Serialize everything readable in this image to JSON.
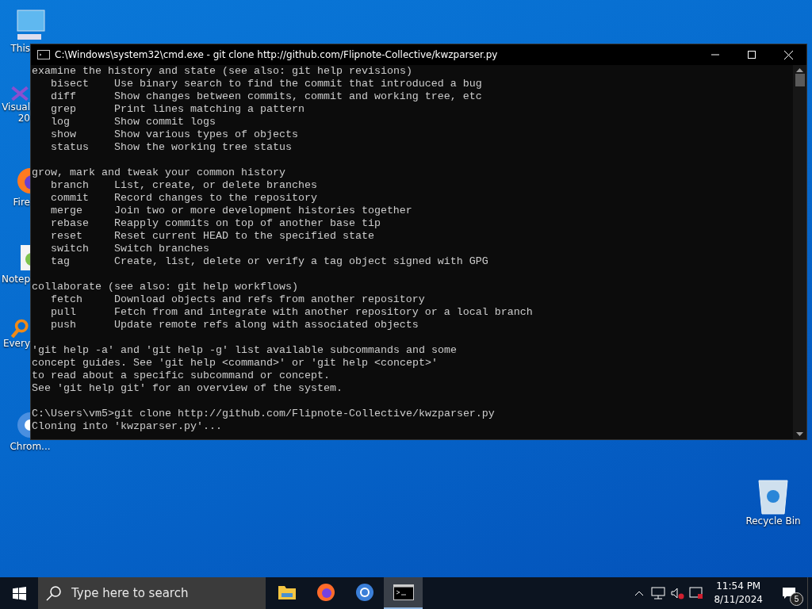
{
  "desktop_icons": [
    {
      "kind": "pc",
      "label_lines": [
        "This"
      ]
    },
    {
      "kind": "vs",
      "label_lines": [
        "Visual",
        "20"
      ]
    },
    {
      "kind": "firefox",
      "label_lines": [
        "Fire"
      ]
    },
    {
      "kind": "notepad",
      "label_lines": [
        "Notep"
      ]
    },
    {
      "kind": "everything",
      "label_lines": [
        "Every"
      ]
    },
    {
      "kind": "chrome",
      "label_lines": [
        "Chrom..."
      ]
    },
    {
      "kind": "recycle",
      "label_lines": [
        "Recycle Bin"
      ]
    }
  ],
  "window": {
    "title": "C:\\Windows\\system32\\cmd.exe - git  clone http://github.com/Flipnote-Collective/kwzparser.py",
    "sections": [
      {
        "heading": "examine the history and state (see also: git help revisions)",
        "commands": [
          {
            "name": "bisect",
            "description": "Use binary search to find the commit that introduced a bug"
          },
          {
            "name": "diff",
            "description": "Show changes between commits, commit and working tree, etc"
          },
          {
            "name": "grep",
            "description": "Print lines matching a pattern"
          },
          {
            "name": "log",
            "description": "Show commit logs"
          },
          {
            "name": "show",
            "description": "Show various types of objects"
          },
          {
            "name": "status",
            "description": "Show the working tree status"
          }
        ]
      },
      {
        "heading": "grow, mark and tweak your common history",
        "commands": [
          {
            "name": "branch",
            "description": "List, create, or delete branches"
          },
          {
            "name": "commit",
            "description": "Record changes to the repository"
          },
          {
            "name": "merge",
            "description": "Join two or more development histories together"
          },
          {
            "name": "rebase",
            "description": "Reapply commits on top of another base tip"
          },
          {
            "name": "reset",
            "description": "Reset current HEAD to the specified state"
          },
          {
            "name": "switch",
            "description": "Switch branches"
          },
          {
            "name": "tag",
            "description": "Create, list, delete or verify a tag object signed with GPG"
          }
        ]
      },
      {
        "heading": "collaborate (see also: git help workflows)",
        "commands": [
          {
            "name": "fetch",
            "description": "Download objects and refs from another repository"
          },
          {
            "name": "pull",
            "description": "Fetch from and integrate with another repository or a local branch"
          },
          {
            "name": "push",
            "description": "Update remote refs along with associated objects"
          }
        ]
      },
      {
        "lines": [
          "'git help -a' and 'git help -g' list available subcommands and some",
          "concept guides. See 'git help <command>' or 'git help <concept>'",
          "to read about a specific subcommand or concept.",
          "See 'git help git' for an overview of the system."
        ]
      },
      {
        "lines": [
          "C:\\Users\\vm5>git clone http://github.com/Flipnote-Collective/kwzparser.py",
          "Cloning into 'kwzparser.py'..."
        ]
      }
    ]
  },
  "taskbar": {
    "search": {
      "placeholder": "Type here to search"
    },
    "apps": [
      {
        "kind": "explorer",
        "selected": false
      },
      {
        "kind": "firefox",
        "selected": false
      },
      {
        "kind": "chrome",
        "selected": false
      },
      {
        "kind": "cmd",
        "selected": true
      }
    ],
    "clock": {
      "time": "11:54 PM",
      "date": "8/11/2024"
    },
    "notifications": {
      "count": "5"
    }
  }
}
